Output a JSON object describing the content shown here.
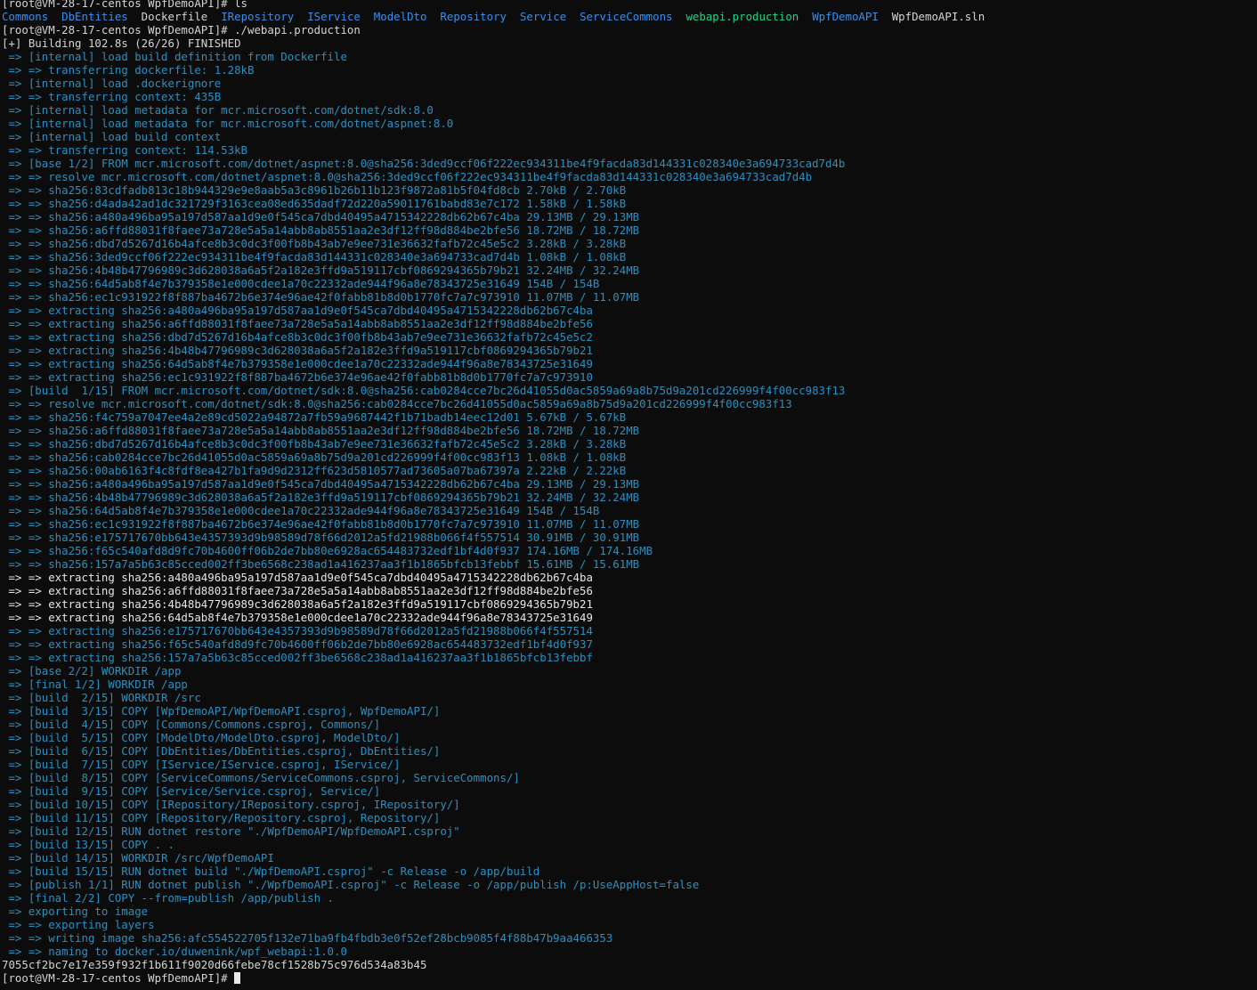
{
  "colors": {
    "background": "#0c0c0c",
    "text": "#c6c6c6",
    "build_step": "#2c8fc0",
    "directory": "#3b8eea",
    "executable": "#23d18b",
    "plain": "#d4d4d4",
    "extracting_active": "#e6e6e6",
    "cursor": "#e8e8e8"
  },
  "terminal": {
    "top_partial": "[root@VM-28-17-centos WpfDemoAPI]# ls",
    "ls_listing": [
      {
        "name": "Commons",
        "kind": "directory"
      },
      {
        "name": "DbEntities",
        "kind": "directory"
      },
      {
        "name": "Dockerfile",
        "kind": "plain"
      },
      {
        "name": "IRepository",
        "kind": "directory"
      },
      {
        "name": "IService",
        "kind": "directory"
      },
      {
        "name": "ModelDto",
        "kind": "directory"
      },
      {
        "name": "Repository",
        "kind": "directory"
      },
      {
        "name": "Service",
        "kind": "directory"
      },
      {
        "name": "ServiceCommons",
        "kind": "directory"
      },
      {
        "name": "webapi.production",
        "kind": "executable"
      },
      {
        "name": "WpfDemoAPI",
        "kind": "directory"
      },
      {
        "name": "WpfDemoAPI.sln",
        "kind": "plain"
      }
    ],
    "lines": [
      {
        "text": "[root@VM-28-17-centos WpfDemoAPI]# ./webapi.production",
        "color": "#d4d4d4"
      },
      {
        "text": "[+] Building 102.8s (26/26) FINISHED",
        "color": "#d4d4d4"
      },
      {
        "text": " => [internal] load build definition from Dockerfile",
        "color": "#2c8fc0"
      },
      {
        "text": " => => transferring dockerfile: 1.28kB",
        "color": "#2c8fc0"
      },
      {
        "text": " => [internal] load .dockerignore",
        "color": "#2c8fc0"
      },
      {
        "text": " => => transferring context: 435B",
        "color": "#2c8fc0"
      },
      {
        "text": " => [internal] load metadata for mcr.microsoft.com/dotnet/sdk:8.0",
        "color": "#2c8fc0"
      },
      {
        "text": " => [internal] load metadata for mcr.microsoft.com/dotnet/aspnet:8.0",
        "color": "#2c8fc0"
      },
      {
        "text": " => [internal] load build context",
        "color": "#2c8fc0"
      },
      {
        "text": " => => transferring context: 114.53kB",
        "color": "#2c8fc0"
      },
      {
        "text": " => [base 1/2] FROM mcr.microsoft.com/dotnet/aspnet:8.0@sha256:3ded9ccf06f222ec934311be4f9facda83d144331c028340e3a694733cad7d4b",
        "color": "#2c8fc0"
      },
      {
        "text": " => => resolve mcr.microsoft.com/dotnet/aspnet:8.0@sha256:3ded9ccf06f222ec934311be4f9facda83d144331c028340e3a694733cad7d4b",
        "color": "#2c8fc0"
      },
      {
        "text": " => => sha256:83cdfadb813c18b944329e9e8aab5a3c8961b26b11b123f9872a81b5f04fd8cb 2.70kB / 2.70kB",
        "color": "#2c8fc0"
      },
      {
        "text": " => => sha256:d4ada42ad1dc321729f3163cea08ed635dadf72d220a59011761babd83e7c172 1.58kB / 1.58kB",
        "color": "#2c8fc0"
      },
      {
        "text": " => => sha256:a480a496ba95a197d587aa1d9e0f545ca7dbd40495a4715342228db62b67c4ba 29.13MB / 29.13MB",
        "color": "#2c8fc0"
      },
      {
        "text": " => => sha256:a6ffd88031f8faee73a728e5a5a14abb8ab8551aa2e3df12ff98d884be2bfe56 18.72MB / 18.72MB",
        "color": "#2c8fc0"
      },
      {
        "text": " => => sha256:dbd7d5267d16b4afce8b3c0dc3f00fb8b43ab7e9ee731e36632fafb72c45e5c2 3.28kB / 3.28kB",
        "color": "#2c8fc0"
      },
      {
        "text": " => => sha256:3ded9ccf06f222ec934311be4f9facda83d144331c028340e3a694733cad7d4b 1.08kB / 1.08kB",
        "color": "#2c8fc0"
      },
      {
        "text": " => => sha256:4b48b47796989c3d628038a6a5f2a182e3ffd9a519117cbf0869294365b79b21 32.24MB / 32.24MB",
        "color": "#2c8fc0"
      },
      {
        "text": " => => sha256:64d5ab8f4e7b379358e1e000cdee1a70c22332ade944f96a8e78343725e31649 154B / 154B",
        "color": "#2c8fc0"
      },
      {
        "text": " => => sha256:ec1c931922f8f887ba4672b6e374e96ae42f0fabb81b8d0b1770fc7a7c973910 11.07MB / 11.07MB",
        "color": "#2c8fc0"
      },
      {
        "text": " => => extracting sha256:a480a496ba95a197d587aa1d9e0f545ca7dbd40495a4715342228db62b67c4ba",
        "color": "#2c8fc0"
      },
      {
        "text": " => => extracting sha256:a6ffd88031f8faee73a728e5a5a14abb8ab8551aa2e3df12ff98d884be2bfe56",
        "color": "#2c8fc0"
      },
      {
        "text": " => => extracting sha256:dbd7d5267d16b4afce8b3c0dc3f00fb8b43ab7e9ee731e36632fafb72c45e5c2",
        "color": "#2c8fc0"
      },
      {
        "text": " => => extracting sha256:4b48b47796989c3d628038a6a5f2a182e3ffd9a519117cbf0869294365b79b21",
        "color": "#2c8fc0"
      },
      {
        "text": " => => extracting sha256:64d5ab8f4e7b379358e1e000cdee1a70c22332ade944f96a8e78343725e31649",
        "color": "#2c8fc0"
      },
      {
        "text": " => => extracting sha256:ec1c931922f8f887ba4672b6e374e96ae42f0fabb81b8d0b1770fc7a7c973910",
        "color": "#2c8fc0"
      },
      {
        "text": " => [build  1/15] FROM mcr.microsoft.com/dotnet/sdk:8.0@sha256:cab0284cce7bc26d41055d0ac5859a69a8b75d9a201cd226999f4f00cc983f13",
        "color": "#2c8fc0"
      },
      {
        "text": " => => resolve mcr.microsoft.com/dotnet/sdk:8.0@sha256:cab0284cce7bc26d41055d0ac5859a69a8b75d9a201cd226999f4f00cc983f13",
        "color": "#2c8fc0"
      },
      {
        "text": " => => sha256:f4c759a7047ee4a2e89cd5022a94872a7fb59a9687442f1b71badb14eec12d01 5.67kB / 5.67kB",
        "color": "#2c8fc0"
      },
      {
        "text": " => => sha256:a6ffd88031f8faee73a728e5a5a14abb8ab8551aa2e3df12ff98d884be2bfe56 18.72MB / 18.72MB",
        "color": "#2c8fc0"
      },
      {
        "text": " => => sha256:dbd7d5267d16b4afce8b3c0dc3f00fb8b43ab7e9ee731e36632fafb72c45e5c2 3.28kB / 3.28kB",
        "color": "#2c8fc0"
      },
      {
        "text": " => => sha256:cab0284cce7bc26d41055d0ac5859a69a8b75d9a201cd226999f4f00cc983f13 1.08kB / 1.08kB",
        "color": "#2c8fc0"
      },
      {
        "text": " => => sha256:00ab6163f4c8fdf8ea427b1fa9d9d2312ff623d5810577ad73605a07ba67397a 2.22kB / 2.22kB",
        "color": "#2c8fc0"
      },
      {
        "text": " => => sha256:a480a496ba95a197d587aa1d9e0f545ca7dbd40495a4715342228db62b67c4ba 29.13MB / 29.13MB",
        "color": "#2c8fc0"
      },
      {
        "text": " => => sha256:4b48b47796989c3d628038a6a5f2a182e3ffd9a519117cbf0869294365b79b21 32.24MB / 32.24MB",
        "color": "#2c8fc0"
      },
      {
        "text": " => => sha256:64d5ab8f4e7b379358e1e000cdee1a70c22332ade944f96a8e78343725e31649 154B / 154B",
        "color": "#2c8fc0"
      },
      {
        "text": " => => sha256:ec1c931922f8f887ba4672b6e374e96ae42f0fabb81b8d0b1770fc7a7c973910 11.07MB / 11.07MB",
        "color": "#2c8fc0"
      },
      {
        "text": " => => sha256:e175717670bb643e4357393d9b98589d78f66d2012a5fd21988b066f4f557514 30.91MB / 30.91MB",
        "color": "#2c8fc0"
      },
      {
        "text": " => => sha256:f65c540afd8d9fc70b4600ff06b2de7bb80e6928ac654483732edf1bf4d0f937 174.16MB / 174.16MB",
        "color": "#2c8fc0"
      },
      {
        "text": " => => sha256:157a7a5b63c85cced002ff3be6568c238ad1a416237aa3f1b1865bfcb13febbf 15.61MB / 15.61MB",
        "color": "#2c8fc0"
      },
      {
        "text": " => => extracting sha256:a480a496ba95a197d587aa1d9e0f545ca7dbd40495a4715342228db62b67c4ba",
        "color": "#e6e6e6"
      },
      {
        "text": " => => extracting sha256:a6ffd88031f8faee73a728e5a5a14abb8ab8551aa2e3df12ff98d884be2bfe56",
        "color": "#e6e6e6"
      },
      {
        "text": " => => extracting sha256:4b48b47796989c3d628038a6a5f2a182e3ffd9a519117cbf0869294365b79b21",
        "color": "#e6e6e6"
      },
      {
        "text": " => => extracting sha256:64d5ab8f4e7b379358e1e000cdee1a70c22332ade944f96a8e78343725e31649",
        "color": "#e6e6e6"
      },
      {
        "text": " => => extracting sha256:e175717670bb643e4357393d9b98589d78f66d2012a5fd21988b066f4f557514",
        "color": "#2c8fc0"
      },
      {
        "text": " => => extracting sha256:f65c540afd8d9fc70b4600ff06b2de7bb80e6928ac654483732edf1bf4d0f937",
        "color": "#2c8fc0"
      },
      {
        "text": " => => extracting sha256:157a7a5b63c85cced002ff3be6568c238ad1a416237aa3f1b1865bfcb13febbf",
        "color": "#2c8fc0"
      },
      {
        "text": " => [base 2/2] WORKDIR /app",
        "color": "#2c8fc0"
      },
      {
        "text": " => [final 1/2] WORKDIR /app",
        "color": "#2c8fc0"
      },
      {
        "text": " => [build  2/15] WORKDIR /src",
        "color": "#2c8fc0"
      },
      {
        "text": " => [build  3/15] COPY [WpfDemoAPI/WpfDemoAPI.csproj, WpfDemoAPI/]",
        "color": "#2c8fc0"
      },
      {
        "text": " => [build  4/15] COPY [Commons/Commons.csproj, Commons/]",
        "color": "#2c8fc0"
      },
      {
        "text": " => [build  5/15] COPY [ModelDto/ModelDto.csproj, ModelDto/]",
        "color": "#2c8fc0"
      },
      {
        "text": " => [build  6/15] COPY [DbEntities/DbEntities.csproj, DbEntities/]",
        "color": "#2c8fc0"
      },
      {
        "text": " => [build  7/15] COPY [IService/IService.csproj, IService/]",
        "color": "#2c8fc0"
      },
      {
        "text": " => [build  8/15] COPY [ServiceCommons/ServiceCommons.csproj, ServiceCommons/]",
        "color": "#2c8fc0"
      },
      {
        "text": " => [build  9/15] COPY [Service/Service.csproj, Service/]",
        "color": "#2c8fc0"
      },
      {
        "text": " => [build 10/15] COPY [IRepository/IRepository.csproj, IRepository/]",
        "color": "#2c8fc0"
      },
      {
        "text": " => [build 11/15] COPY [Repository/Repository.csproj, Repository/]",
        "color": "#2c8fc0"
      },
      {
        "text": " => [build 12/15] RUN dotnet restore \"./WpfDemoAPI/WpfDemoAPI.csproj\"",
        "color": "#2c8fc0"
      },
      {
        "text": " => [build 13/15] COPY . .",
        "color": "#2c8fc0"
      },
      {
        "text": " => [build 14/15] WORKDIR /src/WpfDemoAPI",
        "color": "#2c8fc0"
      },
      {
        "text": " => [build 15/15] RUN dotnet build \"./WpfDemoAPI.csproj\" -c Release -o /app/build",
        "color": "#2c8fc0"
      },
      {
        "text": " => [publish 1/1] RUN dotnet publish \"./WpfDemoAPI.csproj\" -c Release -o /app/publish /p:UseAppHost=false",
        "color": "#2c8fc0"
      },
      {
        "text": " => [final 2/2] COPY --from=publish /app/publish .",
        "color": "#2c8fc0"
      },
      {
        "text": " => exporting to image",
        "color": "#2c8fc0"
      },
      {
        "text": " => => exporting layers",
        "color": "#2c8fc0"
      },
      {
        "text": " => => writing image sha256:afc554522705f132e71ba9fb4fbdb3e0f52ef28bcb9085f4f88b47b9aa466353",
        "color": "#2c8fc0"
      },
      {
        "text": " => => naming to docker.io/duwenink/wpf_webapi:1.0.0",
        "color": "#2c8fc0"
      },
      {
        "text": "7055cf2bc7e17e359f932f1b611f9020d66febe78cf1528b75c976d534a83b45",
        "color": "#d4d4d4"
      }
    ],
    "prompt": "[root@VM-28-17-centos WpfDemoAPI]# "
  }
}
